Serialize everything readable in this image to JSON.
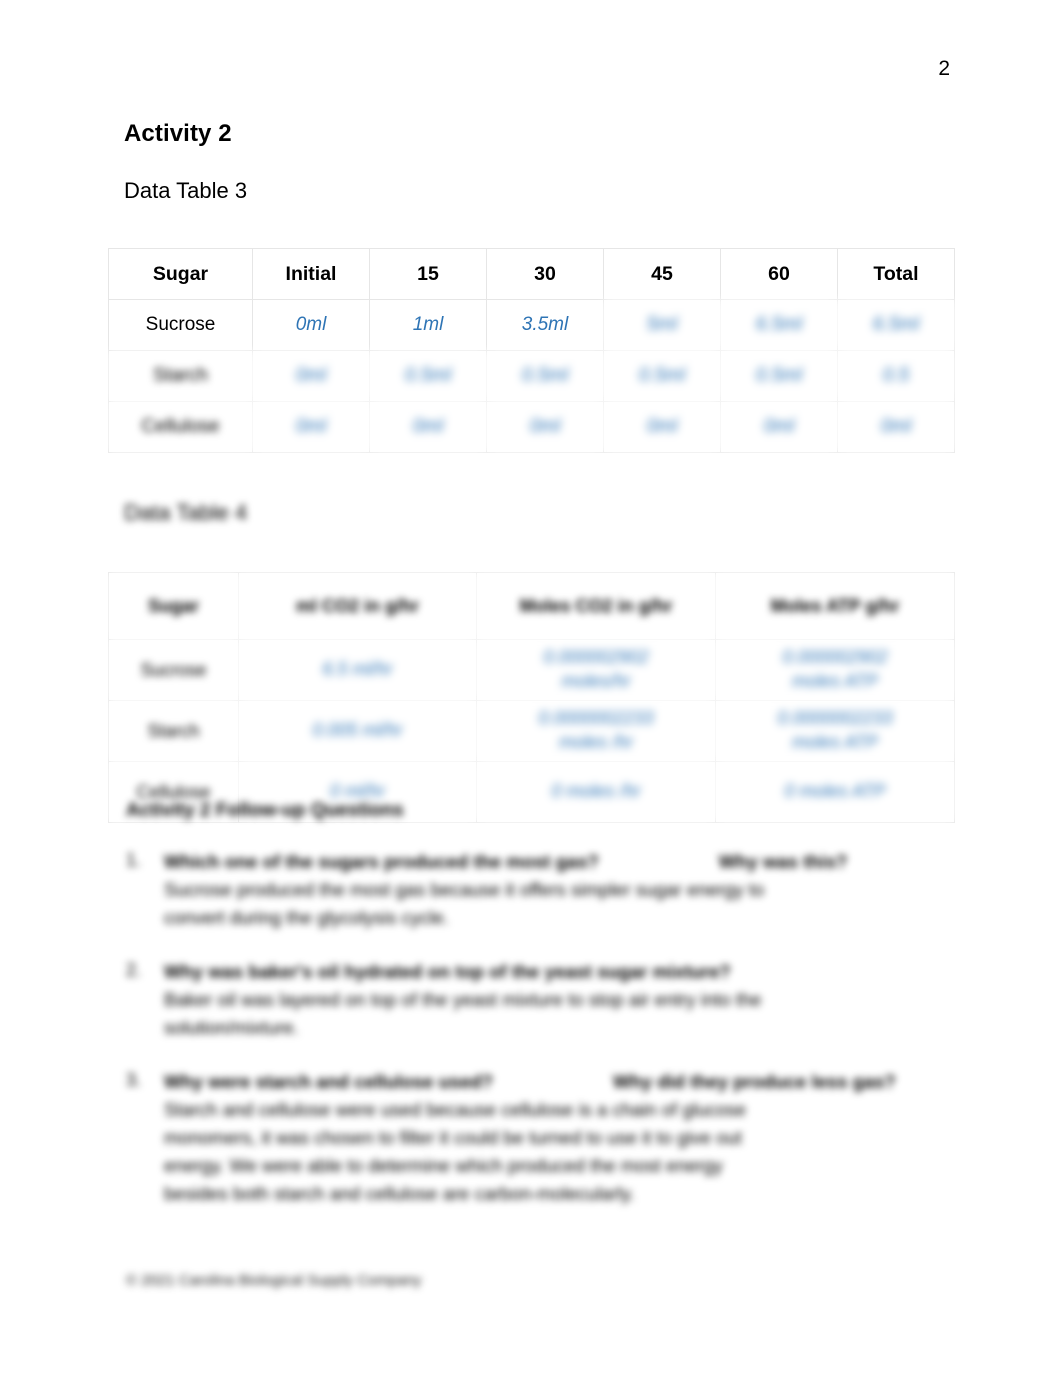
{
  "page": {
    "number": "2"
  },
  "headings": {
    "activity_title": "Activity 2",
    "data_table_3_caption": "Data Table 3",
    "data_table_4_caption": "Data Table 4"
  },
  "data_table_3": {
    "columns": [
      "Sugar",
      "Initial",
      "15",
      "30",
      "45",
      "60",
      "Total"
    ],
    "rows": [
      {
        "label": "Sucrose",
        "values": [
          "0ml",
          "1ml",
          "3.5ml",
          "5ml",
          "6.5ml",
          "6.5ml"
        ]
      },
      {
        "label": "Starch",
        "values": [
          "0ml",
          "0.5ml",
          "0.5ml",
          "0.5ml",
          "0.5ml",
          "0.5"
        ]
      },
      {
        "label": "Cellulose",
        "values": [
          "0ml",
          "0ml",
          "0ml",
          "0ml",
          "0ml",
          "0ml"
        ]
      }
    ]
  },
  "data_table_4": {
    "columns": [
      "Sugar",
      "ml CO2 in g/hr",
      "Moles CO2 in g/hr",
      "Moles ATP g/hr"
    ],
    "rows": [
      {
        "label": "Sucrose",
        "cells": [
          [
            "6.5 ml/hr"
          ],
          [
            "0.000002902",
            "moles/hr"
          ],
          [
            "0.000002902",
            "moles ATP"
          ]
        ]
      },
      {
        "label": "Starch",
        "cells": [
          [
            "0.005 ml/hr"
          ],
          [
            "0.0000002233",
            "moles /hr"
          ],
          [
            "0.0000002233",
            "moles ATP"
          ]
        ]
      },
      {
        "label": "Cellulose",
        "cells": [
          [
            "0 ml/hr"
          ],
          [
            "0 moles /hr"
          ],
          [
            "0 moles ATP"
          ]
        ]
      }
    ]
  },
  "followup": {
    "heading": "Activity 2 Follow-up Questions",
    "questions": [
      {
        "number": "1.",
        "prompt_left": "Which one of the sugars produced the most gas?",
        "prompt_right": "Why was this?",
        "answer_lines": [
          "Sucrose produced the most gas because it offers simpler sugar energy to",
          "convert during the glycolysis cycle."
        ]
      },
      {
        "number": "2.",
        "prompt_left": "Why was baker's oil hydrated on top of the yeast sugar mixture?",
        "prompt_right": "",
        "answer_lines": [
          "Baker oil was layered on top of the yeast mixture to stop air entry into the",
          "solution/mixture."
        ]
      },
      {
        "number": "3.",
        "prompt_left": "Why were starch and cellulose used?",
        "prompt_right": "Why did they produce less gas?",
        "answer_lines": [
          "Starch and cellulose were used because cellulose is a chain of glucose",
          "monomers, it was chosen to filter it could be turned to use it to give out",
          "energy. We were able to determine which produced the most energy",
          "besides both starch and cellulose are carbon-molecularly."
        ]
      }
    ]
  },
  "footer": {
    "note": "© 2021 Carolina Biological Supply Company"
  }
}
